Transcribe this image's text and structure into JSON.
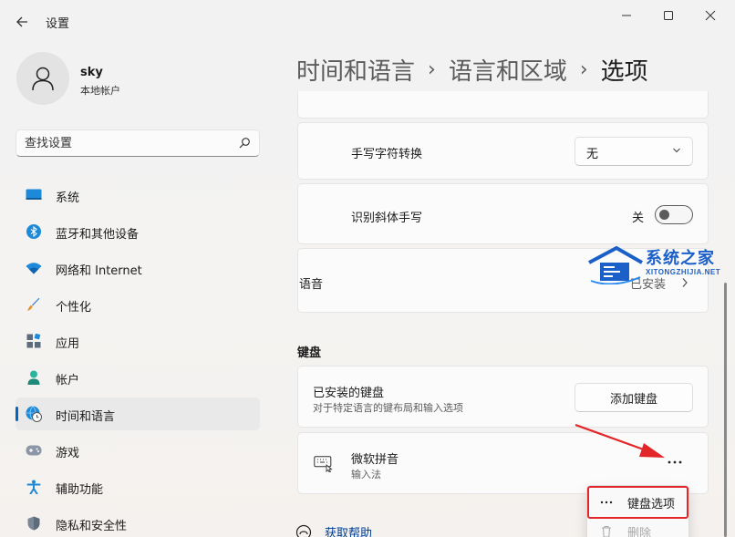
{
  "window": {
    "title": "设置",
    "controls": {
      "minimize": "minimize-icon",
      "maximize": "maximize-icon",
      "close": "close-icon"
    }
  },
  "profile": {
    "name": "sky",
    "account_type": "本地帐户"
  },
  "search": {
    "placeholder": "查找设置"
  },
  "sidebar": {
    "items": [
      {
        "label": "系统",
        "icon": "monitor-icon"
      },
      {
        "label": "蓝牙和其他设备",
        "icon": "bluetooth-icon"
      },
      {
        "label": "网络和 Internet",
        "icon": "wifi-icon"
      },
      {
        "label": "个性化",
        "icon": "brush-icon"
      },
      {
        "label": "应用",
        "icon": "apps-icon"
      },
      {
        "label": "帐户",
        "icon": "person-icon"
      },
      {
        "label": "时间和语言",
        "icon": "globe-clock-icon",
        "selected": true
      },
      {
        "label": "游戏",
        "icon": "gamepad-icon"
      },
      {
        "label": "辅助功能",
        "icon": "accessibility-icon"
      },
      {
        "label": "隐私和安全性",
        "icon": "shield-icon"
      }
    ]
  },
  "breadcrumb": {
    "level1": "时间和语言",
    "level2": "语言和区域",
    "current": "选项",
    "separator": "›"
  },
  "settings": {
    "handwriting_conversion": {
      "label": "手写字符转换",
      "value": "无"
    },
    "italic_handwriting": {
      "label": "识别斜体手写",
      "state_label": "关",
      "on": false
    },
    "speech": {
      "label": "语音",
      "action": "已安装"
    }
  },
  "keyboard": {
    "section_title": "键盘",
    "installed": {
      "title": "已安装的键盘",
      "description": "对于特定语言的键布局和输入选项",
      "add_button": "添加键盘"
    },
    "item": {
      "name": "微软拼音",
      "type": "输入法"
    }
  },
  "context_menu": {
    "items": [
      {
        "label": "键盘选项",
        "icon": "more-icon"
      },
      {
        "label": "删除",
        "icon": "trash-icon",
        "disabled": true
      }
    ]
  },
  "help": {
    "label": "获取帮助"
  },
  "watermark": {
    "title": "系统之家",
    "subtitle": "XITONGZHIJIA.NET"
  },
  "colors": {
    "accent": "#0067c0",
    "annotation": "#e2262a",
    "watermark": "#1b5fc8"
  }
}
